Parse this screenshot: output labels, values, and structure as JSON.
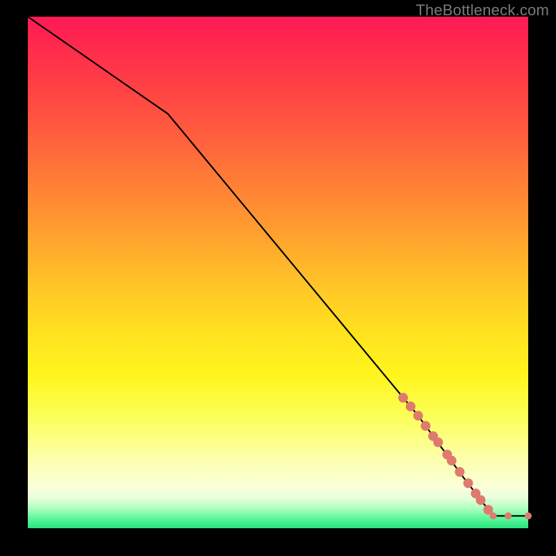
{
  "watermark": "TheBottleneck.com",
  "chart_data": {
    "type": "line",
    "title": "",
    "xlabel": "",
    "ylabel": "",
    "xlim": [
      0,
      100
    ],
    "ylim": [
      0,
      100
    ],
    "grid": false,
    "legend": false,
    "line": {
      "color": "#000000",
      "x": [
        0,
        28,
        78,
        87,
        93,
        100
      ],
      "y": [
        100,
        81,
        22,
        10,
        2.4,
        2.4
      ]
    },
    "markers": {
      "color": "#e07a6f",
      "points": [
        {
          "x": 75.0,
          "y": 25.5
        },
        {
          "x": 76.5,
          "y": 23.8
        },
        {
          "x": 78.0,
          "y": 22.0
        },
        {
          "x": 79.5,
          "y": 20.0
        },
        {
          "x": 81.0,
          "y": 18.0
        },
        {
          "x": 82.0,
          "y": 16.8
        },
        {
          "x": 83.8,
          "y": 14.4
        },
        {
          "x": 84.7,
          "y": 13.2
        },
        {
          "x": 86.3,
          "y": 11.0
        },
        {
          "x": 88.0,
          "y": 8.8
        },
        {
          "x": 89.5,
          "y": 6.8
        },
        {
          "x": 90.5,
          "y": 5.5
        },
        {
          "x": 92.0,
          "y": 3.6
        },
        {
          "x": 93.0,
          "y": 2.4
        },
        {
          "x": 96.0,
          "y": 2.4
        },
        {
          "x": 100.0,
          "y": 2.4
        }
      ],
      "radius_default": 7,
      "radius_small": 5
    }
  }
}
